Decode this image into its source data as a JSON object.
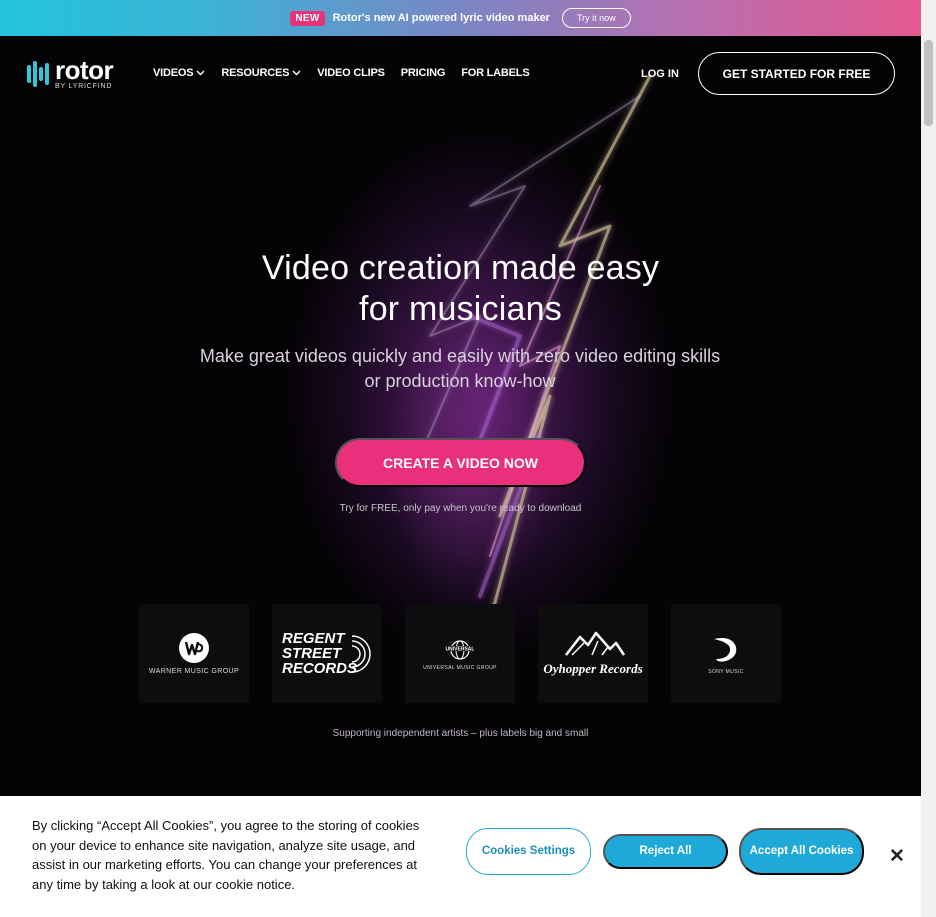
{
  "promo": {
    "badge": "NEW",
    "text": "Rotor's new AI powered lyric video maker",
    "button": "Try it now"
  },
  "nav": {
    "logo_word": "rotor",
    "logo_sub": "BY LYRICFIND",
    "links": [
      {
        "label": "VIDEOS",
        "dropdown": true
      },
      {
        "label": "RESOURCES",
        "dropdown": true
      },
      {
        "label": "VIDEO CLIPS",
        "dropdown": false
      },
      {
        "label": "PRICING",
        "dropdown": false
      },
      {
        "label": "FOR LABELS",
        "dropdown": false
      }
    ],
    "login": "LOG IN",
    "get_started": "GET STARTED FOR FREE"
  },
  "hero": {
    "headline_line1": "Video creation made easy",
    "headline_line2": "for musicians",
    "subhead": "Make great videos quickly and easily with zero video editing skills or production know-how",
    "cta": "CREATE A VIDEO NOW",
    "cta_note": "Try for FREE, only pay when you're ready to download"
  },
  "labels": {
    "items": [
      {
        "name": "WARNER MUSIC GROUP",
        "icon": "warner-music-logo"
      },
      {
        "name": "REGENT STREET RECORDS",
        "icon": "regent-street-logo"
      },
      {
        "name": "UNIVERSAL MUSIC GROUP",
        "icon": "universal-music-logo"
      },
      {
        "name": "Oyhopper Records",
        "icon": "oyhopper-records-logo"
      },
      {
        "name": "SONY MUSIC",
        "icon": "sony-music-logo"
      }
    ],
    "supporting": "Supporting independent artists – plus labels big and small"
  },
  "cookies": {
    "text": "By clicking “Accept All Cookies”, you agree to the storing of cookies on your device to enhance site navigation, analyze site usage, and assist in our marketing efforts. You can change your preferences at any time by taking a look at our cookie notice.",
    "settings": "Cookies Settings",
    "reject": "Reject All",
    "accept": "Accept All Cookies",
    "close_icon": "close-icon"
  },
  "colors": {
    "brand_pink": "#ea2f7d",
    "brand_cyan": "#2fc7da",
    "cookie_blue": "#1ea9d8"
  }
}
